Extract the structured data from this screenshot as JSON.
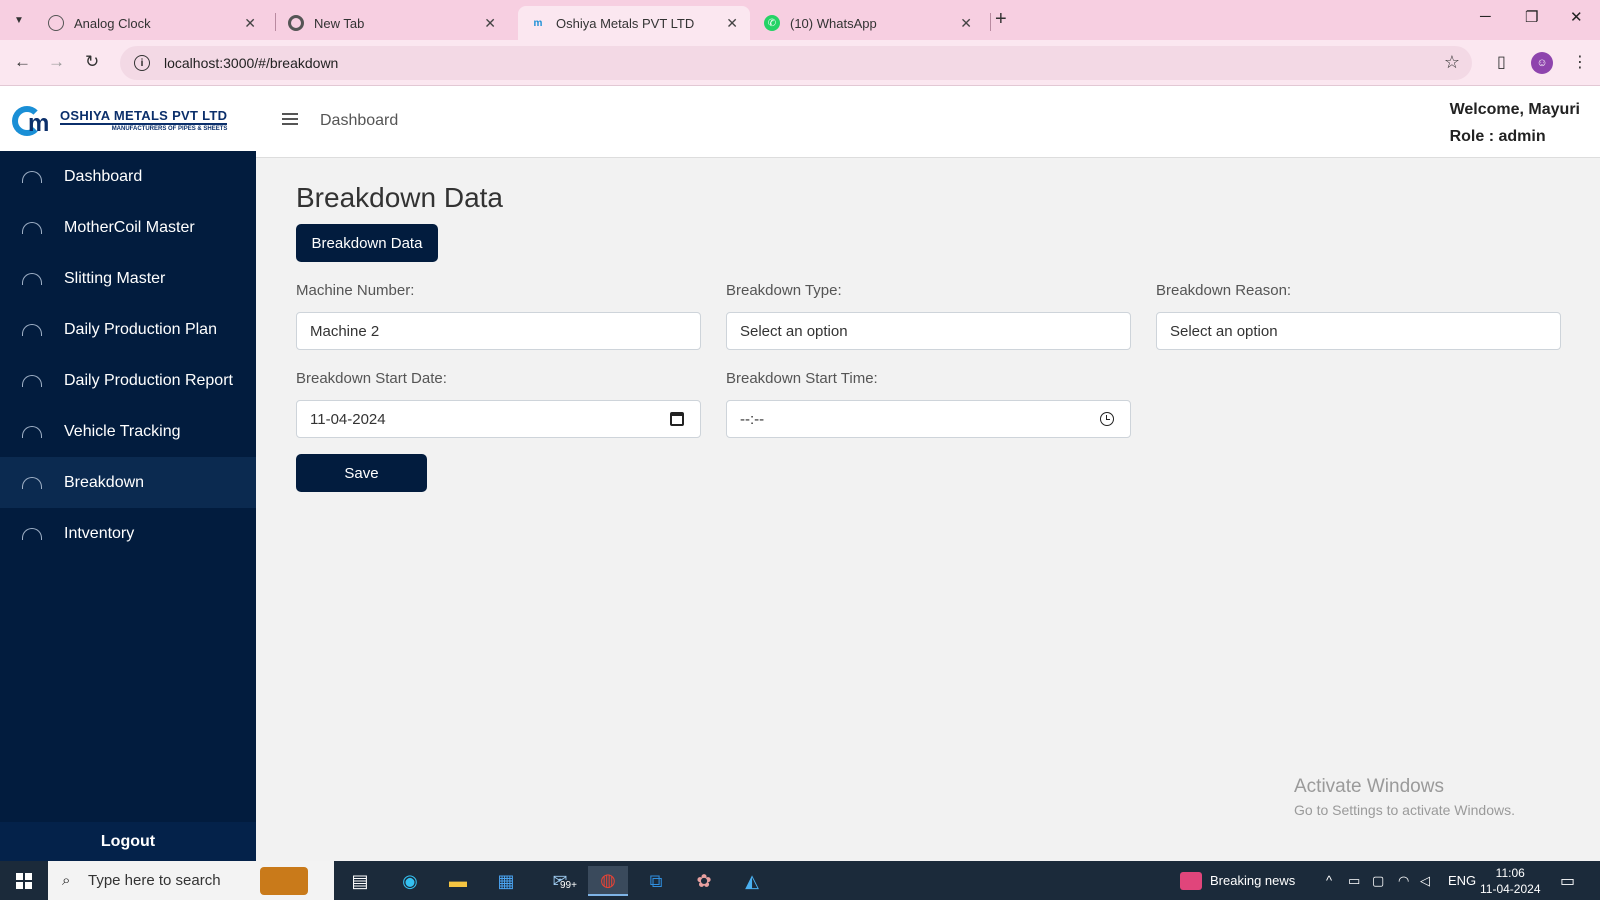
{
  "browser": {
    "tabs": [
      {
        "title": "Analog Clock",
        "icon": "globe-icon"
      },
      {
        "title": "New Tab",
        "icon": "chrome-icon"
      },
      {
        "title": "Oshiya Metals PVT LTD",
        "icon": "oshiya-logo-icon"
      },
      {
        "title": "(10) WhatsApp",
        "icon": "whatsapp-icon"
      }
    ],
    "active_tab": 2,
    "url": "localhost:3000/#/breakdown"
  },
  "header": {
    "logo_title": "OSHIYA METALS PVT LTD",
    "logo_tagline": "MANUFACTURERS OF PIPES & SHEETS",
    "breadcrumb": "Dashboard",
    "welcome": "Welcome, Mayuri",
    "role": "Role : admin"
  },
  "sidebar": {
    "items": [
      {
        "label": "Dashboard"
      },
      {
        "label": "MotherCoil Master"
      },
      {
        "label": "Slitting Master"
      },
      {
        "label": "Daily Production Plan"
      },
      {
        "label": "Daily Production Report"
      },
      {
        "label": "Vehicle Tracking"
      },
      {
        "label": "Breakdown"
      },
      {
        "label": "Intventory"
      }
    ],
    "active_item": "Breakdown",
    "logout_label": "Logout"
  },
  "main": {
    "title": "Breakdown Data",
    "data_button": "Breakdown Data",
    "fields": {
      "machine_number": {
        "label": "Machine Number:",
        "value": "Machine 2"
      },
      "breakdown_type": {
        "label": "Breakdown Type:",
        "value": "Select an option"
      },
      "breakdown_reason": {
        "label": "Breakdown Reason:",
        "value": "Select an option"
      },
      "start_date": {
        "label": "Breakdown Start Date:",
        "value": "11-04-2024"
      },
      "start_time": {
        "label": "Breakdown Start Time:",
        "value": "--:--"
      }
    },
    "save_button": "Save"
  },
  "watermark": {
    "line1": "Activate Windows",
    "line2": "Go to Settings to activate Windows."
  },
  "taskbar": {
    "search_placeholder": "Type here to search",
    "news": "Breaking news",
    "lang": "ENG",
    "time": "11:06",
    "date": "11-04-2024",
    "badge": "99+"
  }
}
